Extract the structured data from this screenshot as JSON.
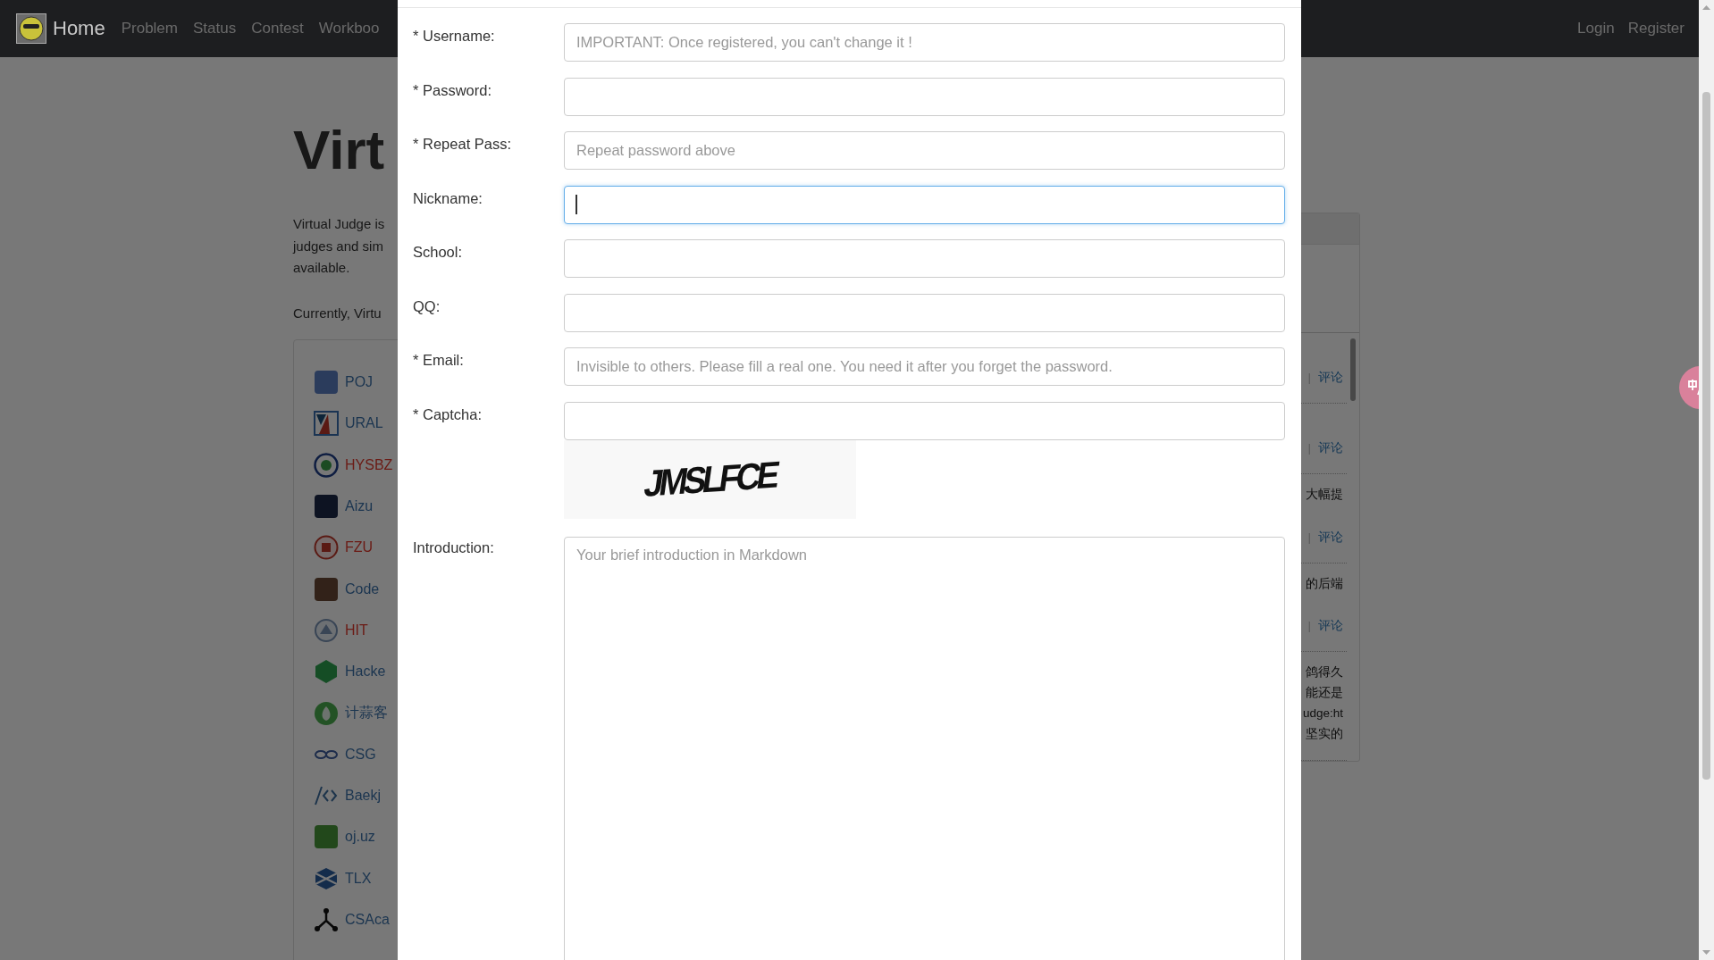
{
  "navbar": {
    "brand": "Home",
    "links": [
      {
        "label": "Problem"
      },
      {
        "label": "Status"
      },
      {
        "label": "Contest"
      },
      {
        "label": "Workboo"
      }
    ],
    "right_links": [
      {
        "label": "Login"
      },
      {
        "label": "Register"
      }
    ]
  },
  "page": {
    "heading": "Virt",
    "intro_lines": [
      "Virtual Judge is",
      "judges and sim",
      "available."
    ],
    "currently": "Currently, Virtu",
    "judges": [
      {
        "name": "POJ",
        "color": "#1b3550"
      },
      {
        "name": "URAL",
        "color": "#1b3550"
      },
      {
        "name": "HYSBZ",
        "color": "#6b1a14"
      },
      {
        "name": "Aizu",
        "color": "#1b3550"
      },
      {
        "name": "FZU",
        "color": "#6b1a14"
      },
      {
        "name": "Code",
        "color": "#1b3550"
      },
      {
        "name": "HIT",
        "color": "#6b1a14"
      },
      {
        "name": "Hacke",
        "color": "#1b3550"
      },
      {
        "name": "计蒜客",
        "color": "#1b3550"
      },
      {
        "name": "CSG",
        "color": "#1b3550"
      },
      {
        "name": "Baekj",
        "color": "#1b3550"
      },
      {
        "name": "oj.uz",
        "color": "#1b3550"
      },
      {
        "name": "TLX",
        "color": "#1b3550"
      },
      {
        "name": "CSAca",
        "color": "#1b3550"
      }
    ],
    "news": [
      {
        "separator": "|",
        "link": "评论"
      },
      {
        "separator": "|",
        "link": "评论"
      },
      {
        "lines": [
          "大幅提"
        ],
        "separator": "|",
        "link": "评论"
      },
      {
        "lines": [
          "的后端"
        ],
        "separator": "|",
        "link": "评论"
      },
      {
        "lines": [
          "鸽得久",
          "能还是",
          "udge:ht",
          "坚实的"
        ]
      }
    ]
  },
  "modal": {
    "fields": [
      {
        "kind": "input",
        "label": "* Username:",
        "placeholder": "IMPORTANT: Once registered, you can't change it !",
        "focused": false
      },
      {
        "kind": "input",
        "label": "* Password:",
        "focused": false
      },
      {
        "kind": "input",
        "label": "* Repeat Pass:",
        "placeholder": "Repeat password above",
        "focused": false
      },
      {
        "kind": "input",
        "label": "Nickname:",
        "focused": true
      },
      {
        "kind": "input",
        "label": "School:",
        "focused": false
      },
      {
        "kind": "input",
        "label": "QQ:",
        "focused": false
      },
      {
        "kind": "input",
        "label": "* Email:",
        "placeholder": "Invisible to others. Please fill a real one. You need it after you forget the password.",
        "focused": false
      },
      {
        "kind": "input",
        "label": "* Captcha:",
        "focused": false
      },
      {
        "kind": "captcha",
        "text": "JMSLFCE"
      },
      {
        "kind": "textarea",
        "label": "Introduction:",
        "placeholder": "Your brief introduction in Markdown",
        "focused": false
      }
    ]
  }
}
